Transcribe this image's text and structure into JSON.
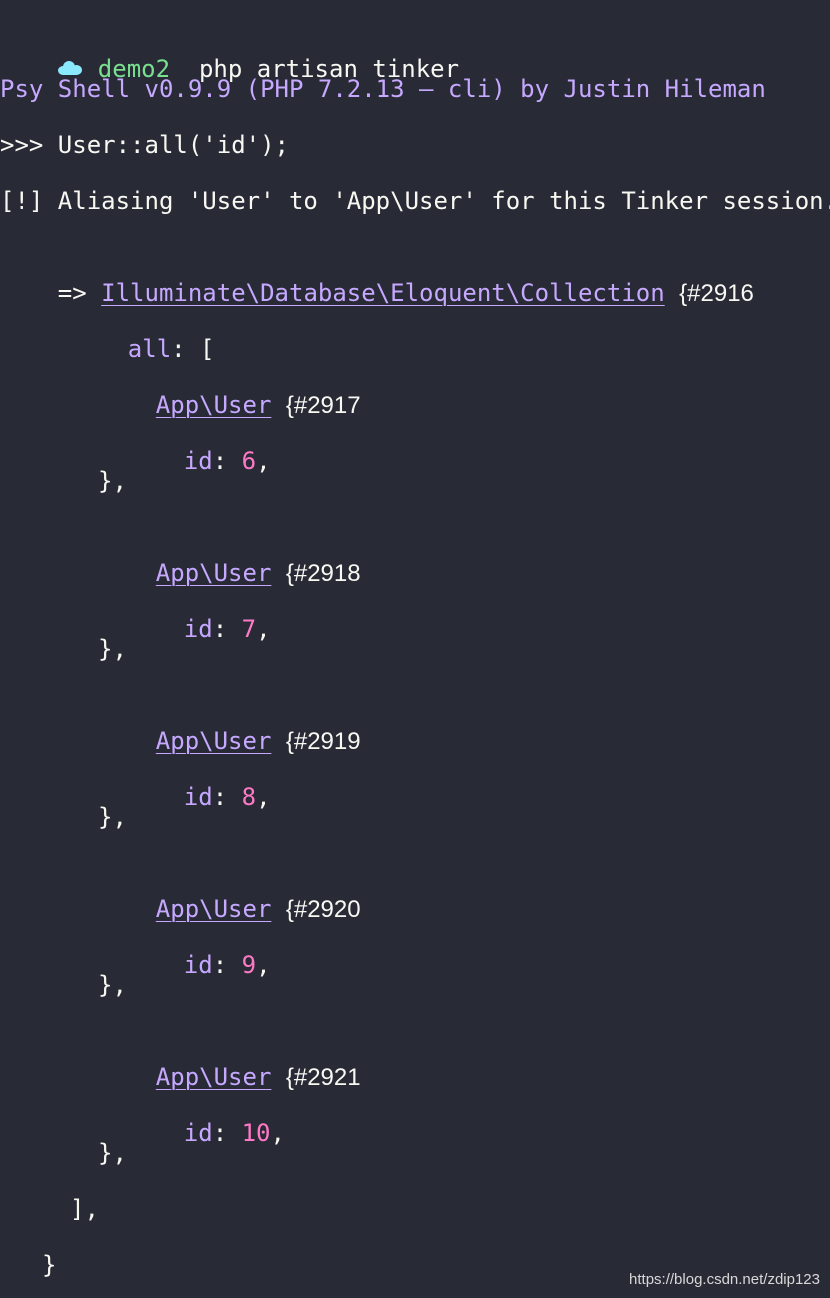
{
  "terminal": {
    "prompt": {
      "icon": "cloud-icon",
      "directory": "demo2",
      "command": "php artisan tinker"
    },
    "banner": "Psy Shell v0.9.9 (PHP 7.2.13 — cli) by Justin Hileman",
    "input_line": ">>> User::all('id');",
    "alias_notice": "[!] Aliasing 'User' to 'App\\User' for this Tinker session.",
    "result": {
      "arrow": "=>",
      "class_name": "Illuminate\\Database\\Eloquent\\Collection",
      "object_id": "{#2916",
      "all_key": "all",
      "all_open": ": [",
      "items": [
        {
          "class": "App\\User",
          "object_id": "{#2917",
          "key": "id",
          "value": "6"
        },
        {
          "class": "App\\User",
          "object_id": "{#2918",
          "key": "id",
          "value": "7"
        },
        {
          "class": "App\\User",
          "object_id": "{#2919",
          "key": "id",
          "value": "8"
        },
        {
          "class": "App\\User",
          "object_id": "{#2920",
          "key": "id",
          "value": "9"
        },
        {
          "class": "App\\User",
          "object_id": "{#2921",
          "key": "id",
          "value": "10"
        }
      ],
      "item_close": "},",
      "all_close": "],",
      "close": "}"
    }
  },
  "watermark": "https://blog.csdn.net/zdip123"
}
